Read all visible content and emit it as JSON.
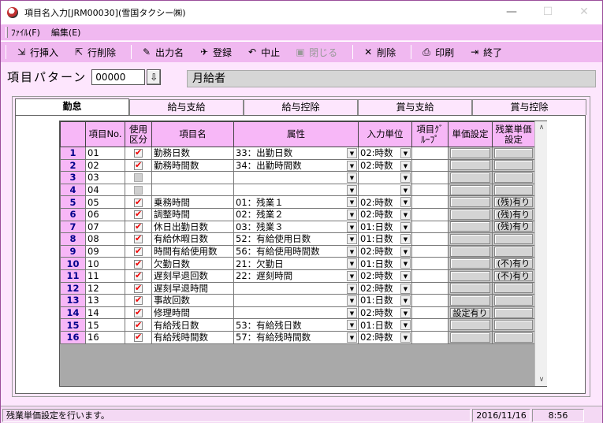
{
  "window": {
    "title": "項目名入力[JRM00030](雪国タクシー㈱)",
    "minimize": "—",
    "maximize": "☐",
    "close": "✕"
  },
  "menu": [
    {
      "label": "ﾌｧｲﾙ(F)"
    },
    {
      "label": "編集(E)"
    }
  ],
  "toolbar": [
    {
      "label": "行挿入",
      "icon": "row-insert-icon",
      "glyph": "⇲",
      "enabled": true
    },
    {
      "label": "行削除",
      "icon": "row-delete-icon",
      "glyph": "⇱",
      "enabled": true
    },
    {
      "label": "出力名",
      "icon": "pencil-icon",
      "glyph": "✎",
      "enabled": true
    },
    {
      "label": "登録",
      "icon": "register-icon",
      "glyph": "✈",
      "enabled": true
    },
    {
      "label": "中止",
      "icon": "undo-icon",
      "glyph": "↶",
      "enabled": true
    },
    {
      "label": "閉じる",
      "icon": "close-doc-icon",
      "glyph": "▣",
      "enabled": false
    },
    {
      "label": "削除",
      "icon": "x-icon",
      "glyph": "✕",
      "enabled": true
    },
    {
      "label": "印刷",
      "icon": "printer-icon",
      "glyph": "⎙",
      "enabled": true
    },
    {
      "label": "終了",
      "icon": "exit-icon",
      "glyph": "⇥",
      "enabled": true
    }
  ],
  "pattern": {
    "label": "項目パターン",
    "value": "00000",
    "button_glyph": "⇩",
    "name": "月給者"
  },
  "tabs": [
    "勤怠",
    "給与支給",
    "給与控除",
    "賞与支給",
    "賞与控除"
  ],
  "active_tab": 0,
  "grid": {
    "headers": [
      "",
      "項目No.",
      "使用\n区分",
      "項目名",
      "属性",
      "入力単位",
      "項目ｸﾞ\nﾙｰﾌﾟ",
      "単価設定",
      "残業単価\n設定"
    ],
    "rows": [
      {
        "rn": "1",
        "no": "01",
        "use": true,
        "name": "勤務日数",
        "attr": "33：出勤日数",
        "unit": "02:時数",
        "price": "",
        "ot": ""
      },
      {
        "rn": "2",
        "no": "02",
        "use": true,
        "name": "勤務時間数",
        "attr": "34：出勤時間数",
        "unit": "02:時数",
        "price": "",
        "ot": ""
      },
      {
        "rn": "3",
        "no": "03",
        "use": false,
        "name": "",
        "attr": "",
        "unit": "",
        "price": "",
        "ot": ""
      },
      {
        "rn": "4",
        "no": "04",
        "use": false,
        "name": "",
        "attr": "",
        "unit": "",
        "price": "",
        "ot": ""
      },
      {
        "rn": "5",
        "no": "05",
        "use": true,
        "name": "乗務時間",
        "attr": "01：残業１",
        "unit": "02:時数",
        "price": "",
        "ot": "(残)有り"
      },
      {
        "rn": "6",
        "no": "06",
        "use": true,
        "name": "調整時間",
        "attr": "02：残業２",
        "unit": "02:時数",
        "price": "",
        "ot": "(残)有り"
      },
      {
        "rn": "7",
        "no": "07",
        "use": true,
        "name": "休日出勤日数",
        "attr": "03：残業３",
        "unit": "01:日数",
        "price": "",
        "ot": "(残)有り"
      },
      {
        "rn": "8",
        "no": "08",
        "use": true,
        "name": "有給休暇日数",
        "attr": "52：有給使用日数",
        "unit": "01:日数",
        "price": "",
        "ot": ""
      },
      {
        "rn": "9",
        "no": "09",
        "use": true,
        "name": "時間有給使用数",
        "attr": "56：有給使用時間数",
        "unit": "02:時数",
        "price": "",
        "ot": ""
      },
      {
        "rn": "10",
        "no": "10",
        "use": true,
        "name": "欠勤日数",
        "attr": "21：欠勤日",
        "unit": "01:日数",
        "price": "",
        "ot": "(不)有り"
      },
      {
        "rn": "11",
        "no": "11",
        "use": true,
        "name": "遅刻早退回数",
        "attr": "22：遅刻時間",
        "unit": "02:時数",
        "price": "",
        "ot": "(不)有り"
      },
      {
        "rn": "12",
        "no": "12",
        "use": true,
        "name": "遅刻早退時間",
        "attr": "",
        "unit": "02:時数",
        "price": "",
        "ot": ""
      },
      {
        "rn": "13",
        "no": "13",
        "use": true,
        "name": "事故回数",
        "attr": "",
        "unit": "01:日数",
        "price": "",
        "ot": ""
      },
      {
        "rn": "14",
        "no": "14",
        "use": true,
        "name": "修理時間",
        "attr": "",
        "unit": "02:時数",
        "price": "設定有り",
        "ot": ""
      },
      {
        "rn": "15",
        "no": "15",
        "use": true,
        "name": "有給残日数",
        "attr": "53：有給残日数",
        "unit": "01:日数",
        "price": "",
        "ot": ""
      },
      {
        "rn": "16",
        "no": "16",
        "use": true,
        "name": "有給残時間数",
        "attr": "57：有給残時間数",
        "unit": "02:時数",
        "price": "",
        "ot": ""
      }
    ]
  },
  "scroll": {
    "up": "∧",
    "down": "∨"
  },
  "status": {
    "message": "残業単価設定を行います。",
    "date": "2016/11/16",
    "time": "8:56"
  }
}
